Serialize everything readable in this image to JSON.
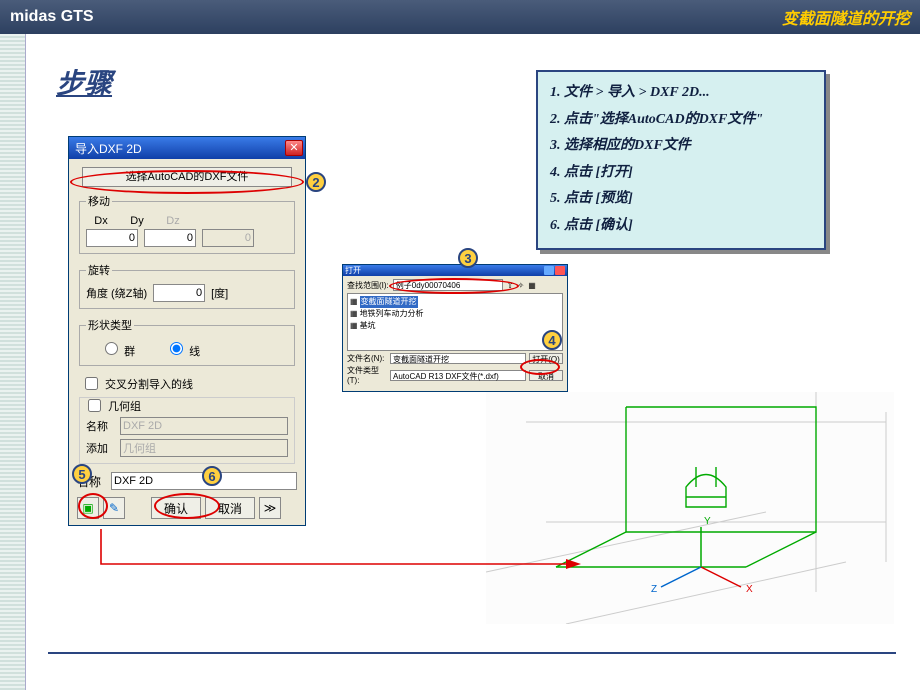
{
  "header": {
    "app_name": "midas GTS",
    "doc_title": "变截面隧道的开挖"
  },
  "section_title": "步骤",
  "steps": {
    "s1": "1. 文件 > 导入 > DXF 2D...",
    "s2": "2. 点击\"选择AutoCAD的DXF文件\"",
    "s3": "3. 选择相应的DXF文件",
    "s4": "4. 点击 [打开]",
    "s5": "5. 点击 [预览]",
    "s6": "6. 点击 [确认]"
  },
  "dialog1": {
    "title": "导入DXF 2D",
    "select_btn": "选择AutoCAD的DXF文件",
    "move_group": "移动",
    "dx_label": "Dx",
    "dy_label": "Dy",
    "dz_label": "Dz",
    "dx": "0",
    "dy": "0",
    "dz": "0",
    "rotate_group": "旋转",
    "angle_label": "角度 (绕Z轴)",
    "angle_val": "0",
    "angle_unit": "[度]",
    "shape_group": "形状类型",
    "shape_group_opt": "群",
    "shape_line_opt": "线",
    "cross_split": "交叉分割导入的线",
    "geom_group": "几何组",
    "name_label": "名称",
    "name_val": "DXF 2D",
    "add_label": "添加",
    "add_val": "几何组",
    "name2_label": "名称",
    "name2_val": "DXF 2D",
    "ok": "确认",
    "cancel": "取消",
    "arrow": "≫"
  },
  "dialog2": {
    "title": "打开",
    "lookin_label": "查找范围(I):",
    "lookin_val": "例子0dy00070406",
    "items": {
      "i1": "变截面隧道开挖",
      "i2": "地铁列车动力分析",
      "i3": "基坑"
    },
    "filename_label": "文件名(N):",
    "filename_val": "变截面隧道开挖",
    "filetype_label": "文件类型(T):",
    "filetype_val": "AutoCAD R13 DXF文件(*.dxf)",
    "open_btn": "打开(O)",
    "cancel_btn": "取消"
  },
  "callouts": {
    "c2": "2",
    "c3": "3",
    "c4": "4",
    "c5": "5",
    "c6": "6"
  },
  "axes": {
    "x": "X",
    "y": "Y",
    "z": "Z"
  }
}
